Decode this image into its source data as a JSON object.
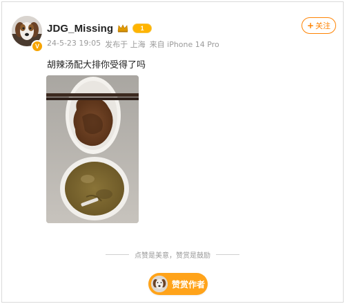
{
  "user": {
    "name": "JDG_Missing",
    "level_badge": "1"
  },
  "post": {
    "date": "24-5-23 19:05",
    "location": "发布于 上海",
    "source": "来自 iPhone 14 Pro",
    "text": "胡辣汤配大排你受得了吗"
  },
  "actions": {
    "follow_label": "关注",
    "reward_hint": "点赞是美意，赞赏是鼓励",
    "reward_label": "赞赏作者"
  },
  "icons": {
    "follow": "plus-icon",
    "crown": "crown-icon",
    "verify": "verified-badge-icon"
  },
  "colors": {
    "accent": "#ff8200",
    "reward_bg": "#ffa31a",
    "badge": "#ffb400",
    "meta_text": "#9a9a9a"
  }
}
